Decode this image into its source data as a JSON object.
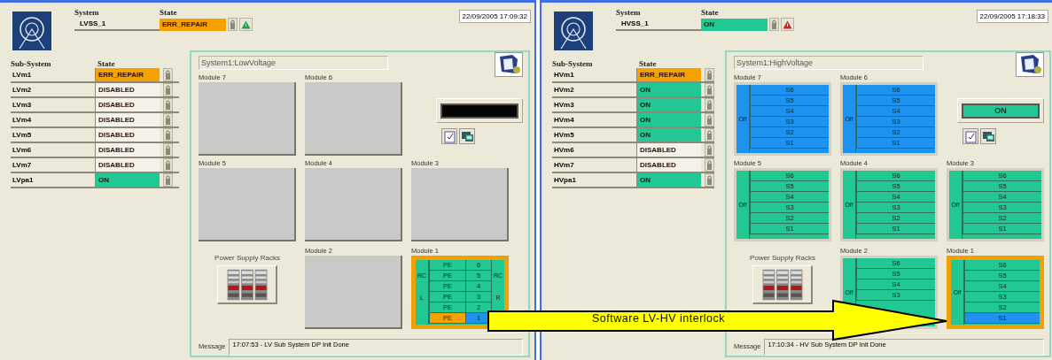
{
  "panels": [
    {
      "system_label": "System",
      "system_value": "LVSS_1",
      "state_label": "State",
      "system_state": {
        "text": "ERR_REPAIR",
        "color": "#f5a100"
      },
      "alarm": false,
      "datetime": "22/09/2005 17:09:32",
      "subsystems_heading": "Sub-System",
      "subsystem_state_heading": "State",
      "subsystems": [
        {
          "name": "LVm1",
          "state_text": "ERR_REPAIR",
          "color": "#f5a100"
        },
        {
          "name": "LVm2",
          "state_text": "DISABLED",
          "color": "#f4f2ea"
        },
        {
          "name": "LVm3",
          "state_text": "DISABLED",
          "color": "#f4f2ea"
        },
        {
          "name": "LVm4",
          "state_text": "DISABLED",
          "color": "#f4f2ea"
        },
        {
          "name": "LVm5",
          "state_text": "DISABLED",
          "color": "#f4f2ea"
        },
        {
          "name": "LVm6",
          "state_text": "DISABLED",
          "color": "#f4f2ea"
        },
        {
          "name": "LVm7",
          "state_text": "DISABLED",
          "color": "#f4f2ea"
        },
        {
          "name": "LVpa1",
          "state_text": "ON",
          "color": "#22c894"
        }
      ],
      "title": "System1:LowVoltage",
      "modules": [
        {
          "label": "Module 7",
          "kind": "empty"
        },
        {
          "label": "Module 6",
          "kind": "empty"
        },
        {
          "label": "Module 5",
          "kind": "empty"
        },
        {
          "label": "Module 4",
          "kind": "empty"
        },
        {
          "label": "Module 3",
          "kind": "empty"
        },
        {
          "label": "Module 2",
          "kind": "empty"
        },
        {
          "label": "Module 1",
          "kind": "channels",
          "color": "#22c894",
          "selected": true,
          "side_left": [
            "RC",
            "L"
          ],
          "side_right": [
            "RC",
            "R"
          ],
          "channels": [
            {
              "cells": [
                {
                  "text": "PE",
                  "color": "#22c894"
                },
                {
                  "text": "6",
                  "color": "#22c894"
                }
              ]
            },
            {
              "cells": [
                {
                  "text": "PE",
                  "color": "#22c894"
                },
                {
                  "text": "5",
                  "color": "#22c894"
                }
              ]
            },
            {
              "cells": [
                {
                  "text": "PE",
                  "color": "#22c894"
                },
                {
                  "text": "4",
                  "color": "#22c894"
                }
              ]
            },
            {
              "cells": [
                {
                  "text": "PE",
                  "color": "#22c894"
                },
                {
                  "text": "3",
                  "color": "#22c894"
                }
              ]
            },
            {
              "cells": [
                {
                  "text": "PE",
                  "color": "#22c894"
                },
                {
                  "text": "2",
                  "color": "#22c894"
                }
              ]
            },
            {
              "cells": [
                {
                  "text": "PE",
                  "color": "#f5a100"
                },
                {
                  "text": "1",
                  "color": "#1e92ee"
                }
              ]
            }
          ]
        }
      ],
      "status_display": {
        "kind": "blank"
      },
      "racks_label": "Power Supply Racks",
      "message_label": "Message",
      "message": "17:07:53 - LV Sub System DP Init Done"
    },
    {
      "system_label": "System",
      "system_value": "HVSS_1",
      "state_label": "State",
      "system_state": {
        "text": "ON",
        "color": "#22c894"
      },
      "alarm": true,
      "datetime": "22/09/2005 17:18:33",
      "subsystems_heading": "Sub-System",
      "subsystem_state_heading": "State",
      "subsystems": [
        {
          "name": "HVm1",
          "state_text": "ERR_REPAIR",
          "color": "#f5a100"
        },
        {
          "name": "HVm2",
          "state_text": "ON",
          "color": "#22c894"
        },
        {
          "name": "HVm3",
          "state_text": "ON",
          "color": "#22c894"
        },
        {
          "name": "HVm4",
          "state_text": "ON",
          "color": "#22c894"
        },
        {
          "name": "HVm5",
          "state_text": "ON",
          "color": "#22c894"
        },
        {
          "name": "HVm6",
          "state_text": "DISABLED",
          "color": "#f4f2ea"
        },
        {
          "name": "HVm7",
          "state_text": "DISABLED",
          "color": "#f4f2ea"
        },
        {
          "name": "HVpa1",
          "state_text": "ON",
          "color": "#22c894"
        }
      ],
      "title": "System1:HighVoltage",
      "modules": [
        {
          "label": "Module 7",
          "kind": "channels",
          "color": "#1e92ee",
          "selected": false,
          "side_left": [
            "Off"
          ],
          "channels": [
            {
              "cells": [
                {
                  "text": "S6",
                  "color": "#1e92ee"
                }
              ]
            },
            {
              "cells": [
                {
                  "text": "S5",
                  "color": "#1e92ee"
                }
              ]
            },
            {
              "cells": [
                {
                  "text": "S4",
                  "color": "#1e92ee"
                }
              ]
            },
            {
              "cells": [
                {
                  "text": "S3",
                  "color": "#1e92ee"
                }
              ]
            },
            {
              "cells": [
                {
                  "text": "S2",
                  "color": "#1e92ee"
                }
              ]
            },
            {
              "cells": [
                {
                  "text": "S1",
                  "color": "#1e92ee"
                }
              ]
            }
          ]
        },
        {
          "label": "Module 6",
          "kind": "channels",
          "color": "#1e92ee",
          "selected": false,
          "side_left": [
            "Off"
          ],
          "channels": [
            {
              "cells": [
                {
                  "text": "S6",
                  "color": "#1e92ee"
                }
              ]
            },
            {
              "cells": [
                {
                  "text": "S5",
                  "color": "#1e92ee"
                }
              ]
            },
            {
              "cells": [
                {
                  "text": "S4",
                  "color": "#1e92ee"
                }
              ]
            },
            {
              "cells": [
                {
                  "text": "S3",
                  "color": "#1e92ee"
                }
              ]
            },
            {
              "cells": [
                {
                  "text": "S2",
                  "color": "#1e92ee"
                }
              ]
            },
            {
              "cells": [
                {
                  "text": "S1",
                  "color": "#1e92ee"
                }
              ]
            }
          ]
        },
        {
          "label": "Module 5",
          "kind": "channels",
          "color": "#22c894",
          "selected": false,
          "side_left": [
            "Off"
          ],
          "channels": [
            {
              "cells": [
                {
                  "text": "S6",
                  "color": "#22c894"
                }
              ]
            },
            {
              "cells": [
                {
                  "text": "S5",
                  "color": "#22c894"
                }
              ]
            },
            {
              "cells": [
                {
                  "text": "S4",
                  "color": "#22c894"
                }
              ]
            },
            {
              "cells": [
                {
                  "text": "S3",
                  "color": "#22c894"
                }
              ]
            },
            {
              "cells": [
                {
                  "text": "S2",
                  "color": "#22c894"
                }
              ]
            },
            {
              "cells": [
                {
                  "text": "S1",
                  "color": "#22c894"
                }
              ]
            }
          ]
        },
        {
          "label": "Module 4",
          "kind": "channels",
          "color": "#22c894",
          "selected": false,
          "side_left": [
            "Off"
          ],
          "channels": [
            {
              "cells": [
                {
                  "text": "S6",
                  "color": "#22c894"
                }
              ]
            },
            {
              "cells": [
                {
                  "text": "S5",
                  "color": "#22c894"
                }
              ]
            },
            {
              "cells": [
                {
                  "text": "S4",
                  "color": "#22c894"
                }
              ]
            },
            {
              "cells": [
                {
                  "text": "S3",
                  "color": "#22c894"
                }
              ]
            },
            {
              "cells": [
                {
                  "text": "S2",
                  "color": "#22c894"
                }
              ]
            },
            {
              "cells": [
                {
                  "text": "S1",
                  "color": "#22c894"
                }
              ]
            }
          ]
        },
        {
          "label": "Module 3",
          "kind": "channels",
          "color": "#22c894",
          "selected": false,
          "side_left": [
            "Off"
          ],
          "channels": [
            {
              "cells": [
                {
                  "text": "S6",
                  "color": "#22c894"
                }
              ]
            },
            {
              "cells": [
                {
                  "text": "S5",
                  "color": "#22c894"
                }
              ]
            },
            {
              "cells": [
                {
                  "text": "S4",
                  "color": "#22c894"
                }
              ]
            },
            {
              "cells": [
                {
                  "text": "S3",
                  "color": "#22c894"
                }
              ]
            },
            {
              "cells": [
                {
                  "text": "S2",
                  "color": "#22c894"
                }
              ]
            },
            {
              "cells": [
                {
                  "text": "S1",
                  "color": "#22c894"
                }
              ]
            }
          ]
        },
        {
          "label": "Module 2",
          "kind": "channels",
          "color": "#22c894",
          "selected": false,
          "side_left": [
            "Off"
          ],
          "channels": [
            {
              "cells": [
                {
                  "text": "S6",
                  "color": "#22c894"
                }
              ]
            },
            {
              "cells": [
                {
                  "text": "S5",
                  "color": "#22c894"
                }
              ]
            },
            {
              "cells": [
                {
                  "text": "S4",
                  "color": "#22c894"
                }
              ]
            },
            {
              "cells": [
                {
                  "text": "S3",
                  "color": "#22c894"
                }
              ]
            }
          ]
        },
        {
          "label": "Module 1",
          "kind": "channels",
          "color": "#22c894",
          "selected": true,
          "side_left": [
            "Off"
          ],
          "channels": [
            {
              "cells": [
                {
                  "text": "S6",
                  "color": "#22c894"
                }
              ]
            },
            {
              "cells": [
                {
                  "text": "S5",
                  "color": "#22c894"
                }
              ]
            },
            {
              "cells": [
                {
                  "text": "S4",
                  "color": "#22c894"
                }
              ]
            },
            {
              "cells": [
                {
                  "text": "S3",
                  "color": "#22c894"
                }
              ]
            },
            {
              "cells": [
                {
                  "text": "S2",
                  "color": "#22c894"
                }
              ]
            },
            {
              "cells": [
                {
                  "text": "S1",
                  "color": "#1e92ee"
                }
              ]
            }
          ]
        }
      ],
      "status_display": {
        "kind": "text",
        "text": "ON",
        "color": "#22c894"
      },
      "racks_label": "Power Supply Racks",
      "message_label": "Message",
      "message": "17:10:34 - HV Sub System DP Init Done"
    }
  ],
  "annotation": {
    "text": "Software LV-HV interlock"
  }
}
